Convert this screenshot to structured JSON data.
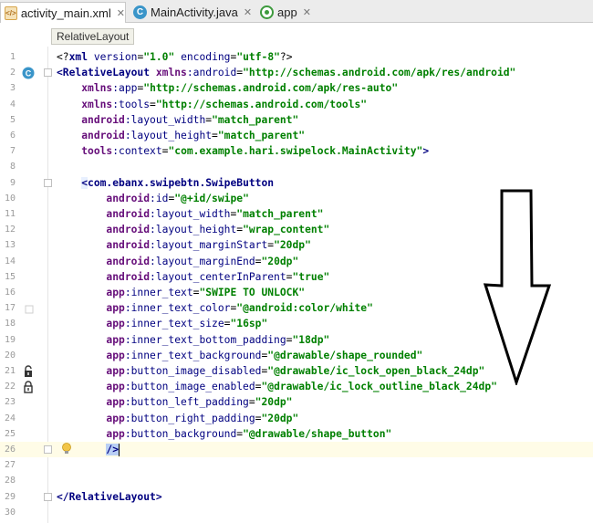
{
  "tabs": [
    {
      "label": "activity_main.xml",
      "icon": "xml-file-icon",
      "active": true
    },
    {
      "label": "MainActivity.java",
      "icon": "java-class-icon",
      "active": false
    },
    {
      "label": "app",
      "icon": "android-app-icon",
      "active": false
    }
  ],
  "breadcrumb": "RelativeLayout",
  "code_lines": [
    {
      "n": "1",
      "text": "<?xml version=\"1.0\" encoding=\"utf-8\"?>"
    },
    {
      "n": "2",
      "text": "<RelativeLayout xmlns:android=\"http://schemas.android.com/apk/res/android\""
    },
    {
      "n": "3",
      "text": "    xmlns:app=\"http://schemas.android.com/apk/res-auto\""
    },
    {
      "n": "4",
      "text": "    xmlns:tools=\"http://schemas.android.com/tools\""
    },
    {
      "n": "5",
      "text": "    android:layout_width=\"match_parent\""
    },
    {
      "n": "6",
      "text": "    android:layout_height=\"match_parent\""
    },
    {
      "n": "7",
      "text": "    tools:context=\"com.example.hari.swipelock.MainActivity\">"
    },
    {
      "n": "8",
      "text": ""
    },
    {
      "n": "9",
      "text": "    <com.ebanx.swipebtn.SwipeButton"
    },
    {
      "n": "10",
      "text": "        android:id=\"@+id/swipe\""
    },
    {
      "n": "11",
      "text": "        android:layout_width=\"match_parent\""
    },
    {
      "n": "12",
      "text": "        android:layout_height=\"wrap_content\""
    },
    {
      "n": "13",
      "text": "        android:layout_marginStart=\"20dp\""
    },
    {
      "n": "14",
      "text": "        android:layout_marginEnd=\"20dp\""
    },
    {
      "n": "15",
      "text": "        android:layout_centerInParent=\"true\""
    },
    {
      "n": "16",
      "text": "        app:inner_text=\"SWIPE TO UNLOCK\""
    },
    {
      "n": "17",
      "text": "        app:inner_text_color=\"@android:color/white\""
    },
    {
      "n": "18",
      "text": "        app:inner_text_size=\"16sp\""
    },
    {
      "n": "19",
      "text": "        app:inner_text_bottom_padding=\"18dp\""
    },
    {
      "n": "20",
      "text": "        app:inner_text_background=\"@drawable/shape_rounded\""
    },
    {
      "n": "21",
      "text": "        app:button_image_disabled=\"@drawable/ic_lock_open_black_24dp\""
    },
    {
      "n": "22",
      "text": "        app:button_image_enabled=\"@drawable/ic_lock_outline_black_24dp\""
    },
    {
      "n": "23",
      "text": "        app:button_left_padding=\"20dp\""
    },
    {
      "n": "24",
      "text": "        app:button_right_padding=\"20dp\""
    },
    {
      "n": "25",
      "text": "        app:button_background=\"@drawable/shape_button\""
    },
    {
      "n": "26",
      "text": "        />"
    },
    {
      "n": "27",
      "text": ""
    },
    {
      "n": "28",
      "text": ""
    },
    {
      "n": "29",
      "text": "</RelativeLayout>"
    },
    {
      "n": "30",
      "text": ""
    }
  ],
  "colors": {
    "tag": "#000080",
    "attribute": "#660e7a",
    "value": "#008000",
    "caret_row": "#fffce7"
  },
  "gutter_icons": {
    "2": "class-c-icon",
    "17": "white-color-swatch-icon",
    "21": "lock-open-icon",
    "22": "lock-closed-icon",
    "26": "lightbulb-icon"
  }
}
